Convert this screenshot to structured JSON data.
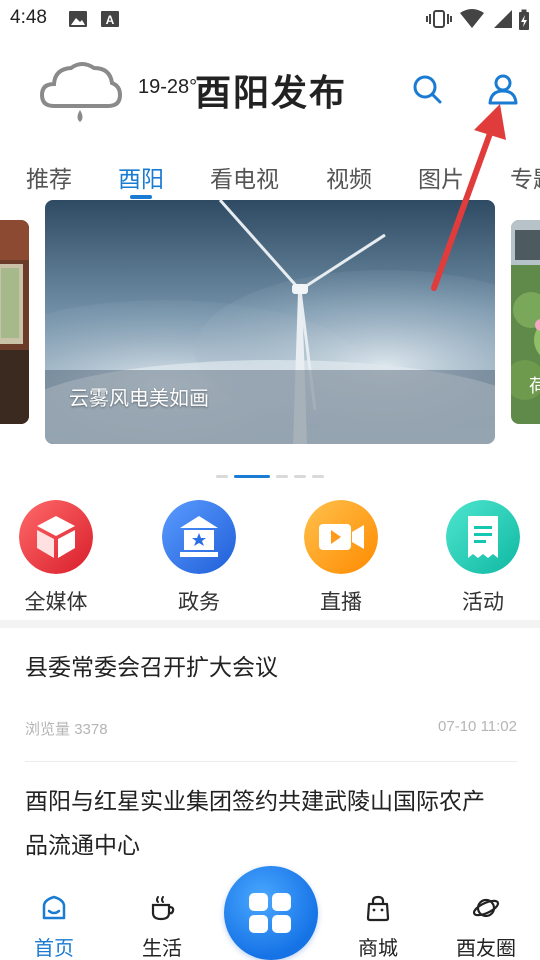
{
  "status_bar": {
    "time": "4:48"
  },
  "header": {
    "weather_icon": "rain-cloud-icon",
    "temperature": "19-28°",
    "brand_title": "酉阳发布",
    "search_icon": "search-icon",
    "user_icon": "user-icon"
  },
  "tabs": [
    {
      "label": "推荐",
      "active": false
    },
    {
      "label": "酉阳",
      "active": true
    },
    {
      "label": "看电视",
      "active": false
    },
    {
      "label": "视频",
      "active": false
    },
    {
      "label": "图片",
      "active": false
    },
    {
      "label": "专题",
      "active": false
    }
  ],
  "banner": {
    "caption": "云雾风电美如画",
    "next_caption_partial": "荷",
    "slide_count": 5,
    "active_slide": 2
  },
  "entries": [
    {
      "label": "全媒体",
      "icon": "box-icon",
      "color": "#e8343b"
    },
    {
      "label": "政务",
      "icon": "government-icon",
      "color": "#2b6fe6"
    },
    {
      "label": "直播",
      "icon": "video-camera-icon",
      "color": "#ff9a1a"
    },
    {
      "label": "活动",
      "icon": "receipt-icon",
      "color": "#14c7b1"
    }
  ],
  "news": [
    {
      "title": "县委常委会召开扩大会议",
      "views_label": "浏览量",
      "views": "3378",
      "date": "07-10 11:02"
    },
    {
      "title_line1": "酉阳与红星实业集团签约共建武陵山国际农产",
      "title_line2": "品流通中心"
    }
  ],
  "bottom_nav": [
    {
      "label": "首页",
      "icon": "home-icon",
      "active": true
    },
    {
      "label": "生活",
      "icon": "coffee-cup-icon",
      "active": false
    },
    {
      "label": "商城",
      "icon": "shopping-bag-icon",
      "active": false
    },
    {
      "label": "酉友圈",
      "icon": "planet-icon",
      "active": false
    }
  ],
  "colors": {
    "accent": "#1a7bd3",
    "arrow": "#e03c3c"
  }
}
